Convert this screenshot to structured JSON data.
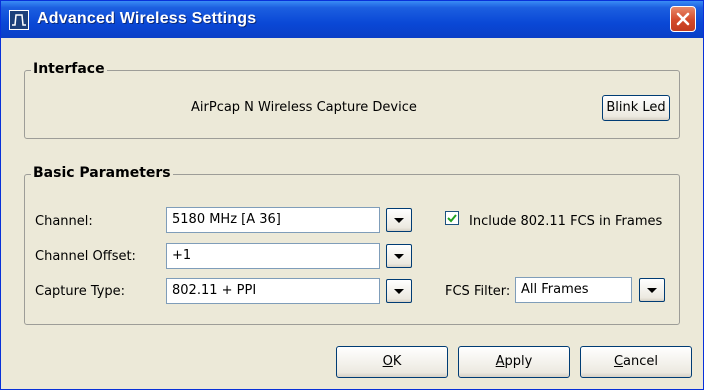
{
  "window": {
    "title": "Advanced Wireless Settings"
  },
  "interface": {
    "legend": "Interface",
    "device_name": "AirPcap N Wireless Capture Device",
    "blink_button": "Blink Led"
  },
  "basic": {
    "legend": "Basic Parameters",
    "channel": {
      "label": "Channel:",
      "value": "5180 MHz [A 36]"
    },
    "channel_offset": {
      "label": "Channel Offset:",
      "value": "+1"
    },
    "capture_type": {
      "label": "Capture Type:",
      "value": "802.11 + PPI"
    },
    "fcs_in_frames": {
      "label": "Include 802.11 FCS in Frames",
      "checked": true
    },
    "fcs_filter": {
      "label": "FCS Filter:",
      "value": "All Frames"
    }
  },
  "buttons": {
    "ok": "OK",
    "apply": "Apply",
    "cancel": "Cancel"
  },
  "icons": {
    "app": "airpcap-app-icon",
    "close": "close-icon",
    "dropdown": "chevron-down-icon",
    "check": "check-icon"
  },
  "colors": {
    "titlebar": "#0a48d6",
    "close": "#d34a2b",
    "dialog_bg": "#ece9d8"
  }
}
